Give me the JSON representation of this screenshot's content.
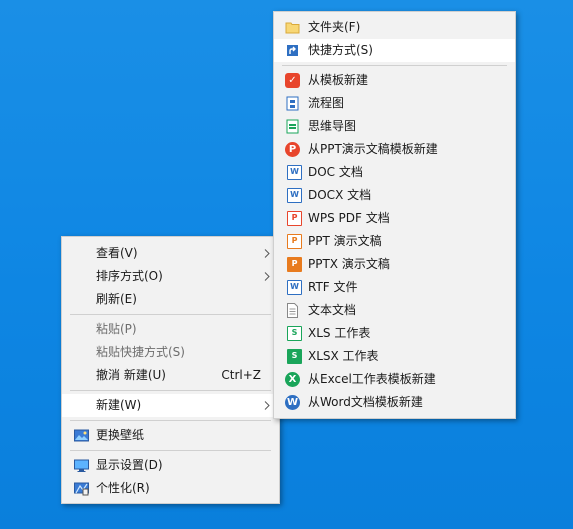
{
  "context_menu": {
    "items": [
      {
        "label": "查看(V)"
      },
      {
        "label": "排序方式(O)"
      },
      {
        "label": "刷新(E)"
      },
      {
        "label": "粘贴(P)"
      },
      {
        "label": "粘贴快捷方式(S)"
      },
      {
        "label": "撤消 新建(U)",
        "shortcut": "Ctrl+Z"
      },
      {
        "label": "新建(W)"
      },
      {
        "label": "更换壁纸"
      },
      {
        "label": "显示设置(D)"
      },
      {
        "label": "个性化(R)"
      }
    ]
  },
  "new_submenu": {
    "items": [
      {
        "label": "文件夹(F)",
        "icon": "folder-icon"
      },
      {
        "label": "快捷方式(S)",
        "icon": "shortcut-icon"
      },
      {
        "label": "从模板新建",
        "icon": "template-icon"
      },
      {
        "label": "流程图",
        "icon": "flowchart-icon"
      },
      {
        "label": "思维导图",
        "icon": "mindmap-icon"
      },
      {
        "label": "从PPT演示文稿模板新建",
        "icon": "ppt-template-icon"
      },
      {
        "label": "DOC 文档",
        "icon": "doc-icon"
      },
      {
        "label": "DOCX 文档",
        "icon": "docx-icon"
      },
      {
        "label": "WPS PDF 文档",
        "icon": "pdf-icon"
      },
      {
        "label": "PPT 演示文稿",
        "icon": "ppt-icon"
      },
      {
        "label": "PPTX 演示文稿",
        "icon": "pptx-icon"
      },
      {
        "label": "RTF 文件",
        "icon": "rtf-icon"
      },
      {
        "label": "文本文档",
        "icon": "text-document-icon"
      },
      {
        "label": "XLS 工作表",
        "icon": "xls-icon"
      },
      {
        "label": "XLSX 工作表",
        "icon": "xlsx-icon"
      },
      {
        "label": "从Excel工作表模板新建",
        "icon": "excel-template-icon"
      },
      {
        "label": "从Word文档模板新建",
        "icon": "word-template-icon"
      }
    ]
  },
  "colors": {
    "desktop": "#0e86e3",
    "menu_bg": "#f2f2f2",
    "disabled_text": "#6d6d6d",
    "wps_red": "#e8452c",
    "wps_blue": "#2e6fc2",
    "wps_green": "#1aa55a",
    "wps_orange": "#e87b1e"
  }
}
